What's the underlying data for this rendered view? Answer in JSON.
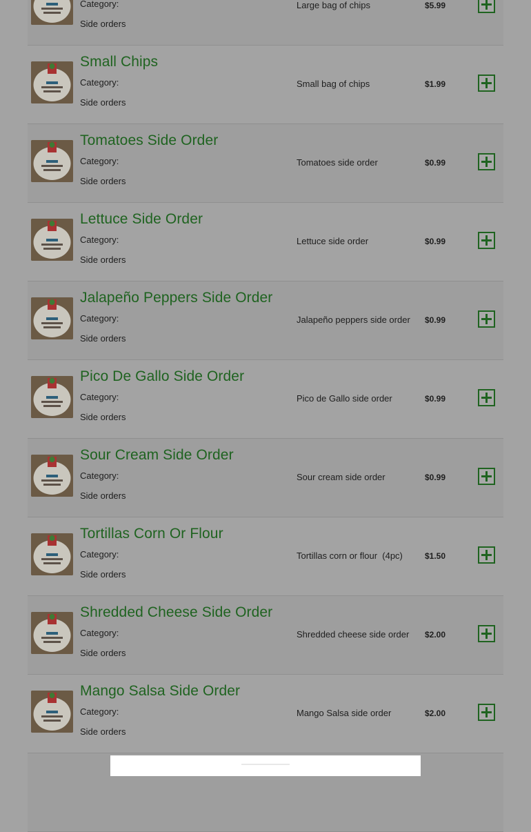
{
  "items": [
    {
      "name": "",
      "category_label": "Category:",
      "category": "Side orders",
      "description": "Large bag of chips",
      "price": "$5.99"
    },
    {
      "name": "Small Chips",
      "category_label": "Category:",
      "category": "Side orders",
      "description": "Small bag of chips",
      "price": "$1.99"
    },
    {
      "name": "Tomatoes Side Order",
      "category_label": "Category:",
      "category": "Side orders",
      "description": "Tomatoes side order",
      "price": "$0.99"
    },
    {
      "name": "Lettuce Side Order",
      "category_label": "Category:",
      "category": "Side orders",
      "description": "Lettuce side order",
      "price": "$0.99"
    },
    {
      "name": "Jalapeño Peppers Side Order",
      "category_label": "Category:",
      "category": "Side orders",
      "description": "Jalapeño peppers side order",
      "price": "$0.99"
    },
    {
      "name": "Pico De Gallo Side Order",
      "category_label": "Category:",
      "category": "Side orders",
      "description": "Pico de Gallo side order",
      "price": "$0.99"
    },
    {
      "name": "Sour Cream Side Order",
      "category_label": "Category:",
      "category": "Side orders",
      "description": "Sour cream side order",
      "price": "$0.99"
    },
    {
      "name": "Tortillas Corn Or Flour",
      "category_label": "Category:",
      "category": "Side orders",
      "description": "Tortillas corn or flour  (4pc)",
      "price": "$1.50"
    },
    {
      "name": "Shredded Cheese Side Order",
      "category_label": "Category:",
      "category": "Side orders",
      "description": "Shredded cheese side order",
      "price": "$2.00"
    },
    {
      "name": "Mango Salsa Side Order",
      "category_label": "Category:",
      "category": "Side orders",
      "description": "Mango Salsa side order",
      "price": "$2.00"
    }
  ],
  "icons": {
    "thumbnail": "restaurant-logo-image",
    "add": "plus-square-icon"
  },
  "colors": {
    "title": "#1f6320",
    "add_button": "#1f6320",
    "overlay_background": "#a3a3a3"
  }
}
